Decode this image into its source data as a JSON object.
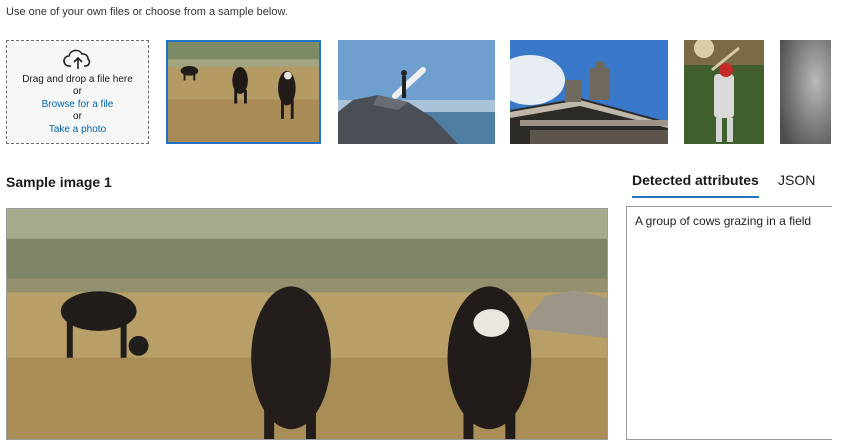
{
  "instructions": "Use one of your own files or choose from a sample below.",
  "dropzone": {
    "line1": "Drag and drop a file here",
    "or1": "or",
    "browse_link": "Browse for a file",
    "or2": "or",
    "photo_link": "Take a photo",
    "icon": "cloud-upload-icon"
  },
  "samples": [
    {
      "name": "cows grazing",
      "selected": true
    },
    {
      "name": "surfer on rocks",
      "selected": false
    },
    {
      "name": "building statues",
      "selected": false
    },
    {
      "name": "baseball batter",
      "selected": false
    },
    {
      "name": "grey partial",
      "selected": false
    }
  ],
  "section_title": "Sample image 1",
  "tabs": [
    {
      "label": "Detected attributes",
      "active": true
    },
    {
      "label": "JSON",
      "active": false
    }
  ],
  "result": {
    "caption": "A group of cows grazing in a field"
  },
  "colors": {
    "accent": "#1f75c4",
    "link": "#0063b1"
  }
}
